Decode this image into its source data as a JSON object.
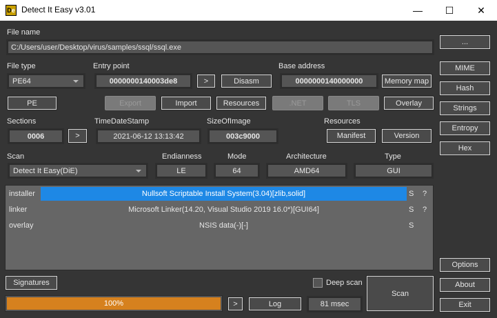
{
  "window": {
    "title": "Detect It Easy v3.01",
    "logo": "DiE",
    "minimize": "—",
    "maximize": "☐",
    "close": "✕"
  },
  "file_name": {
    "label": "File name",
    "value": "C:/Users/user/Desktop/virus/samples/ssql/ssql.exe",
    "browse": "..."
  },
  "file_type": {
    "label": "File type",
    "value": "PE64"
  },
  "entry_point": {
    "label": "Entry point",
    "value": "0000000140003de8",
    "go": ">",
    "disasm": "Disasm"
  },
  "base_address": {
    "label": "Base address",
    "value": "0000000140000000",
    "memory_map": "Memory map"
  },
  "buttons": {
    "pe": "PE",
    "export": "Export",
    "import": "Import",
    "resources": "Resources",
    "net": ".NET",
    "tls": "TLS",
    "overlay": "Overlay"
  },
  "sections": {
    "label": "Sections",
    "value": "0006",
    "go": ">"
  },
  "timedatestamp": {
    "label": "TimeDateStamp",
    "value": "2021-06-12 13:13:42"
  },
  "sizeofimage": {
    "label": "SizeOfImage",
    "value": "003c9000"
  },
  "resources": {
    "label": "Resources",
    "manifest": "Manifest",
    "version": "Version"
  },
  "scan": {
    "label": "Scan",
    "value": "Detect It Easy(DiE)"
  },
  "endianness": {
    "label": "Endianness",
    "value": "LE"
  },
  "mode": {
    "label": "Mode",
    "value": "64"
  },
  "architecture": {
    "label": "Architecture",
    "value": "AMD64"
  },
  "type": {
    "label": "Type",
    "value": "GUI"
  },
  "results": [
    {
      "type": "installer",
      "name": "Nullsoft Scriptable Install System(3.04)[zlib,solid]",
      "s": "S",
      "q": "?"
    },
    {
      "type": "linker",
      "name": "Microsoft Linker(14.20, Visual Studio 2019 16.0*)[GUI64]",
      "s": "S",
      "q": "?"
    },
    {
      "type": "overlay",
      "name": "NSIS data(-)[-]",
      "s": "S",
      "q": ""
    }
  ],
  "side": {
    "mime": "MIME",
    "hash": "Hash",
    "strings": "Strings",
    "entropy": "Entropy",
    "hex": "Hex",
    "options": "Options",
    "about": "About",
    "exit": "Exit"
  },
  "bottom": {
    "signatures": "Signatures",
    "deep_scan": "Deep scan",
    "deep_scan_checked": false,
    "scan": "Scan",
    "progress_text": "100%",
    "progress": 100,
    "go": ">",
    "log": "Log",
    "time": "81 msec"
  },
  "colors": {
    "progress": "#d6811e",
    "selection": "#1e88e5"
  }
}
